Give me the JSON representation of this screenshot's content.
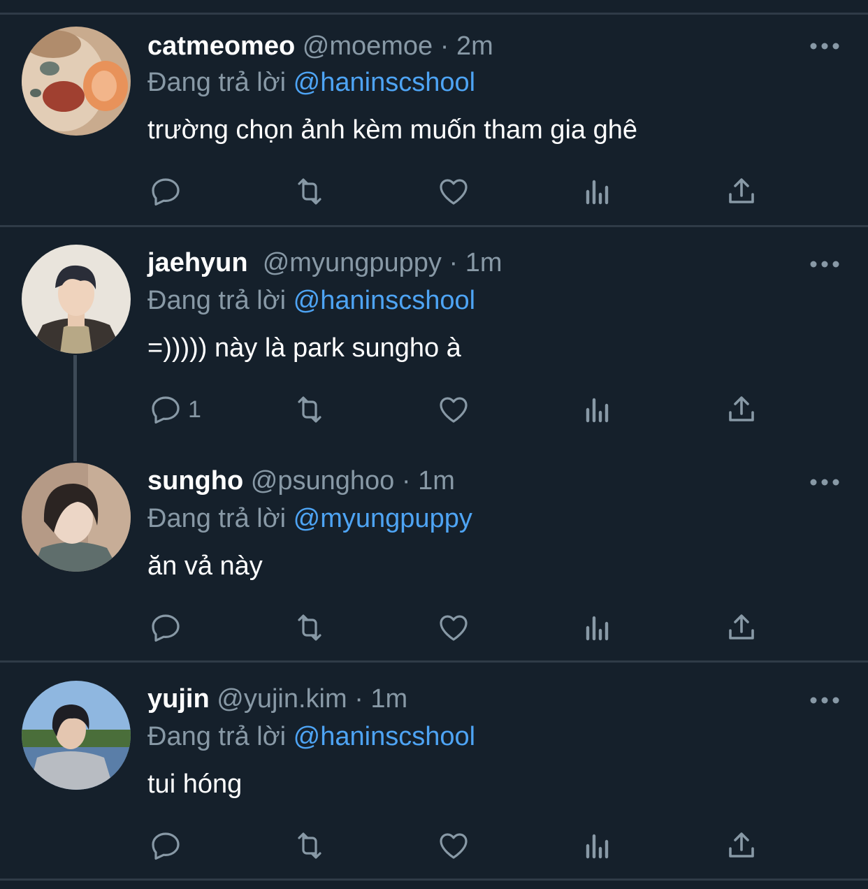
{
  "colors": {
    "background": "#15202b",
    "divider": "#2f3b47",
    "secondary_text": "#8899a6",
    "link": "#4ea4f4",
    "icon": "#8899a6"
  },
  "reply_label": "Đang trả lời",
  "tweets": [
    {
      "name": "catmeomeo",
      "handle": "@moemoe",
      "separator": "·",
      "time": "2m",
      "reply_to": "@haninscshool",
      "text": "trường chọn ảnh kèm muốn tham gia ghê",
      "reply_count": ""
    },
    {
      "name": "jaehyun",
      "handle": "@myungpuppy",
      "separator": "·",
      "time": "1m",
      "reply_to": "@haninscshool",
      "text": "=))))) này là park sungho à",
      "reply_count": "1"
    },
    {
      "name": "sungho",
      "handle": "@psunghoo",
      "separator": "·",
      "time": "1m",
      "reply_to": "@myungpuppy",
      "text": "ăn vả này",
      "reply_count": ""
    },
    {
      "name": "yujin",
      "handle": "@yujin.kim",
      "separator": "·",
      "time": "1m",
      "reply_to": "@haninscshool",
      "text": "tui hóng",
      "reply_count": ""
    }
  ],
  "action_icons": [
    "reply-icon",
    "retweet-icon",
    "like-icon",
    "analytics-icon",
    "share-icon"
  ]
}
